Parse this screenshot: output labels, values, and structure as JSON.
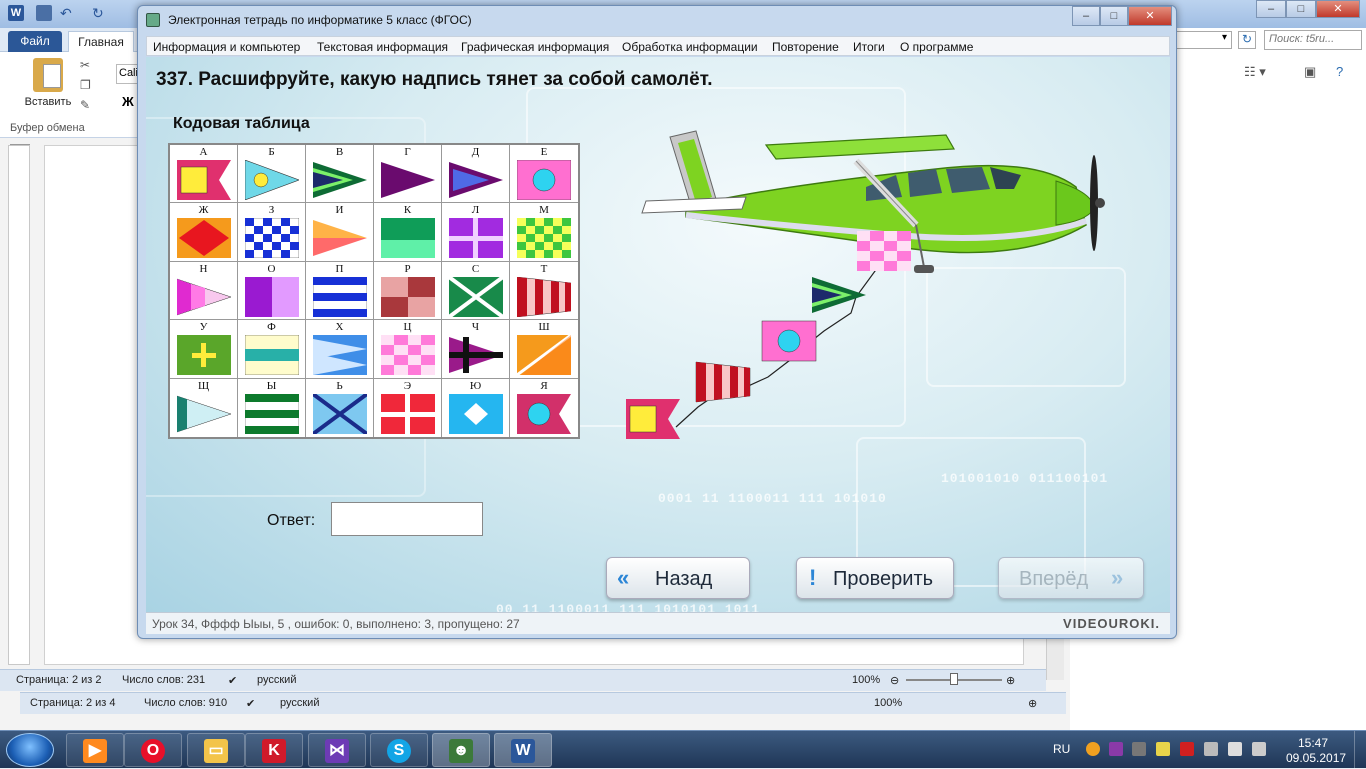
{
  "word": {
    "tab_file": "Файл",
    "tab_home": "Главная",
    "paste_label": "Вставить",
    "clipboard_group": "Буфер обмена",
    "font_name": "Cali",
    "bold": "Ж",
    "search_placeholder": "Поиск: t5ru...",
    "status1": {
      "page": "Страница: 2 из 2",
      "words": "Число слов: 231",
      "language": "русский",
      "zoom": "100%"
    },
    "status2": {
      "page": "Страница: 2 из 4",
      "words": "Число слов: 910",
      "language": "русский",
      "zoom": "100%"
    }
  },
  "app": {
    "title": "Электронная тетрадь по информатике 5 класс (ФГОС)",
    "menu": [
      "Информация и компьютер",
      "Текстовая информация",
      "Графическая информация",
      "Обработка информации",
      "Повторение",
      "Итоги",
      "О программе"
    ],
    "question": "337. Расшифруйте, какую надпись тянет за собой самолёт.",
    "code_table_title": "Кодовая таблица",
    "flags": [
      "А",
      "Б",
      "В",
      "Г",
      "Д",
      "Е",
      "Ж",
      "З",
      "И",
      "К",
      "Л",
      "М",
      "Н",
      "О",
      "П",
      "Р",
      "С",
      "Т",
      "У",
      "Ф",
      "Х",
      "Ц",
      "Ч",
      "Ш",
      "Щ",
      "Ы",
      "Ь",
      "Э",
      "Ю",
      "Я"
    ],
    "answer_label": "Ответ:",
    "answer_value": "",
    "buttons": {
      "back": "Назад",
      "check": "Проверить",
      "next": "Вперёд"
    },
    "status": "Урок 34, Фффф Ыыы, 5 , ошибок: 0, выполнено: 3, пропущено: 27",
    "brand": "VIDEOUROKI.",
    "deco_binary_1": "0001 11 1100011 111 101010",
    "deco_binary_2": "00 11 1100011 111 1010101 1011",
    "deco_binary_3": "101001010 011100101"
  },
  "taskbar": {
    "language": "RU",
    "time": "15:47",
    "date": "09.05.2017"
  },
  "colors": {
    "accent": "#2c86d6",
    "plane_green": "#7ed321",
    "word_blue": "#2b5797"
  }
}
